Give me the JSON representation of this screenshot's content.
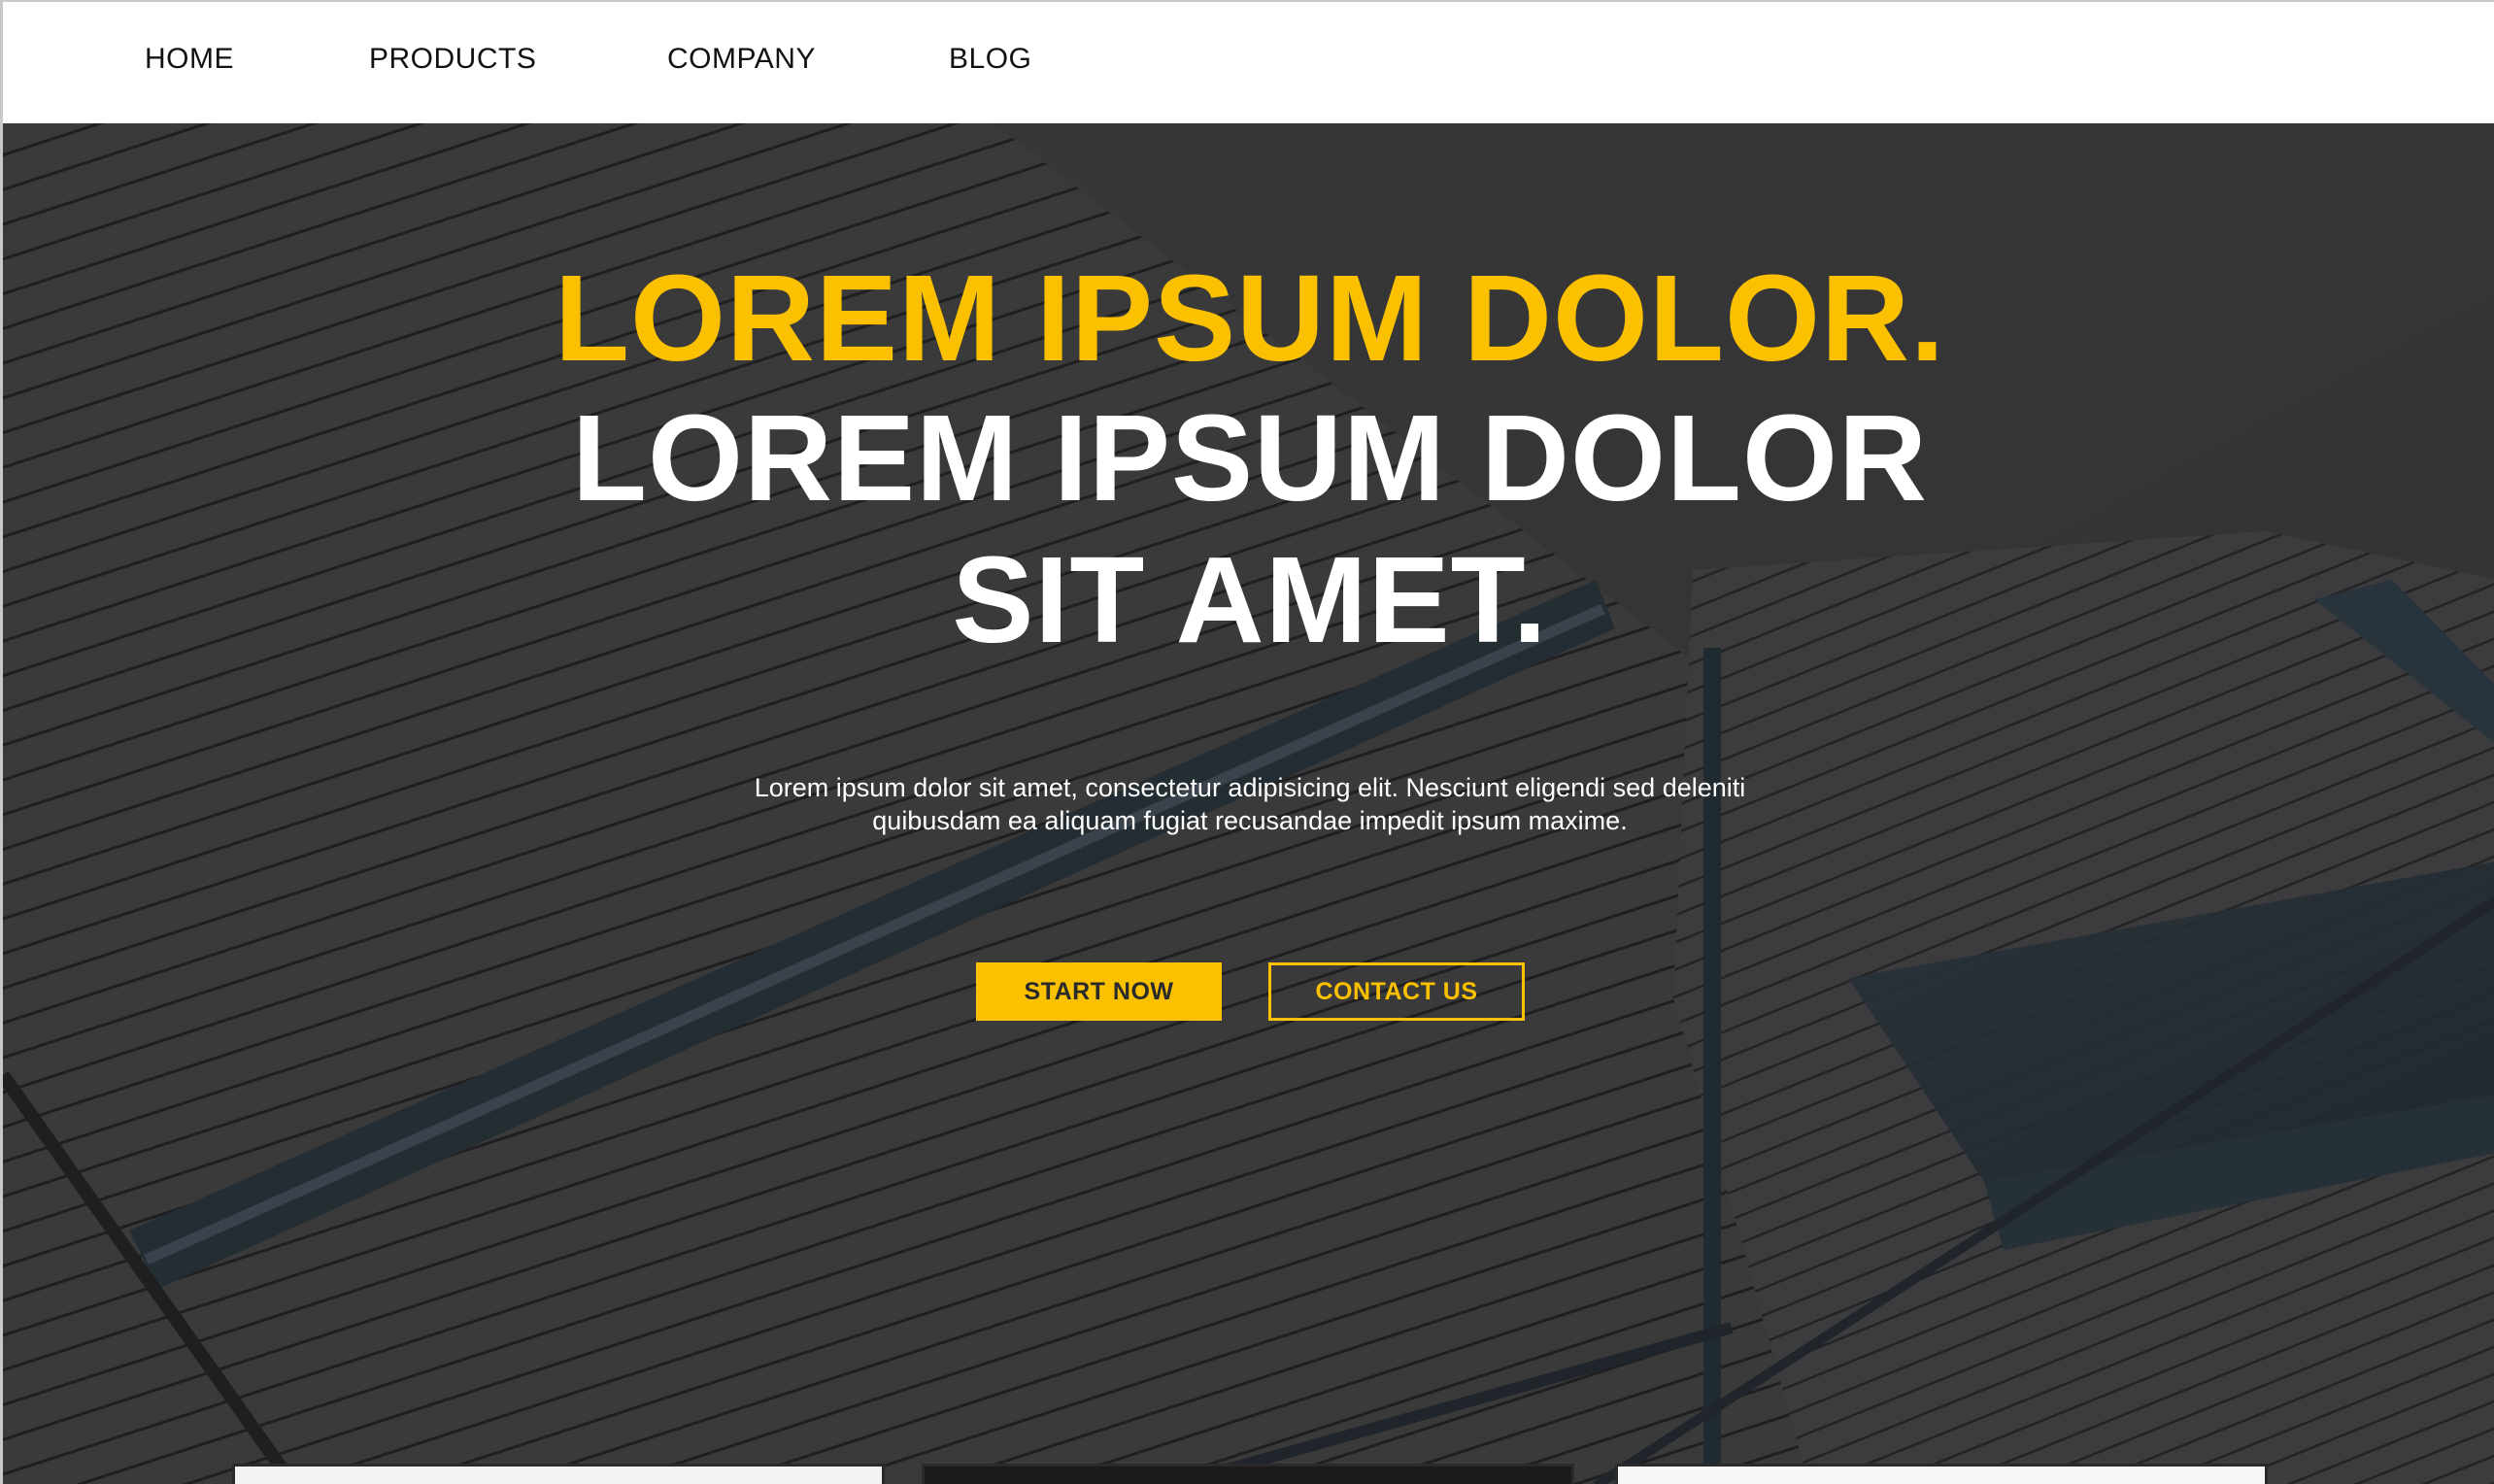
{
  "nav": {
    "items": [
      {
        "label": "HOME"
      },
      {
        "label": "PRODUCTS"
      },
      {
        "label": "COMPANY"
      },
      {
        "label": "BLOG"
      }
    ]
  },
  "hero": {
    "headline_accent": "LOREM IPSUM DOLOR.",
    "headline_line_1": "LOREM IPSUM DOLOR",
    "headline_line_2": "SIT AMET.",
    "lede_line_1": "Lorem ipsum dolor sit amet, consectetur adipisicing elit. Nesciunt eligendi sed deleniti",
    "lede_line_2": "quibusdam ea aliquam fugiat recusandae impedit ipsum maxime.",
    "primary_button": "START NOW",
    "secondary_button": "CONTACT US",
    "background_image": "modern-building-roof-photo"
  },
  "colors": {
    "accent": "#fbc000",
    "hero_bg": "#3d3d3f",
    "nav_bg": "#ffffff",
    "text_dark": "#111111",
    "text_light": "#ffffff"
  }
}
